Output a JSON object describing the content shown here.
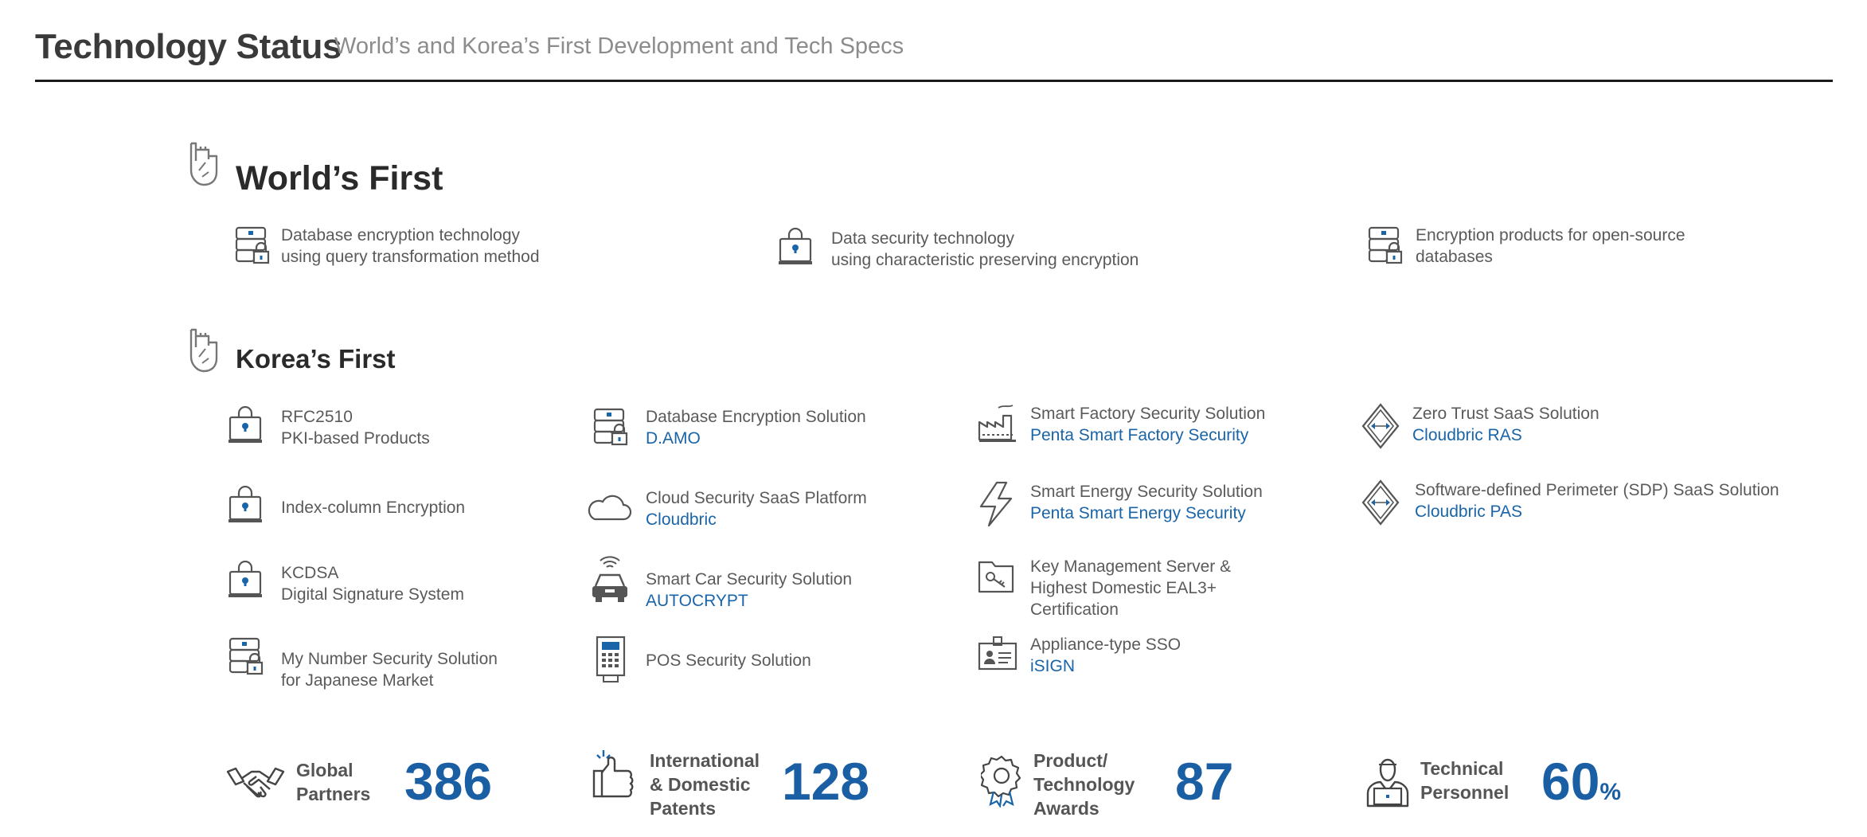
{
  "header": {
    "title": "Technology Status",
    "subtitle": "World’s and Korea’s First Development and Tech Specs"
  },
  "world_first": {
    "title": "World’s First",
    "items": [
      {
        "icon": "database-lock-icon",
        "lines": [
          "Database encryption technology",
          "using query transformation method"
        ]
      },
      {
        "icon": "laptop-lock-icon",
        "lines": [
          "Data security technology",
          "using characteristic preserving encryption"
        ]
      },
      {
        "icon": "database-lock-icon",
        "lines": [
          "Encryption products for open-source",
          "databases"
        ]
      }
    ]
  },
  "korea_first": {
    "title": "Korea’s First",
    "columns": [
      [
        {
          "icon": "laptop-lock-icon",
          "lines": [
            "RFC2510",
            "PKI-based Products"
          ],
          "link": ""
        },
        {
          "icon": "laptop-lock-icon",
          "lines": [
            "Index-column Encryption"
          ],
          "link": ""
        },
        {
          "icon": "laptop-lock-icon",
          "lines": [
            "KCDSA",
            "Digital Signature System"
          ],
          "link": ""
        },
        {
          "icon": "database-lock-icon",
          "lines": [
            "My Number Security Solution",
            "for Japanese Market"
          ],
          "link": ""
        }
      ],
      [
        {
          "icon": "database-lock-icon",
          "lines": [
            "Database Encryption Solution"
          ],
          "link": "D.AMO"
        },
        {
          "icon": "cloud-icon",
          "lines": [
            "Cloud Security SaaS Platform"
          ],
          "link": "Cloudbric"
        },
        {
          "icon": "car-icon",
          "lines": [
            "Smart Car Security Solution"
          ],
          "link": "AUTOCRYPT"
        },
        {
          "icon": "pos-terminal-icon",
          "lines": [
            "POS Security Solution"
          ],
          "link": ""
        }
      ],
      [
        {
          "icon": "factory-icon",
          "lines": [
            "Smart Factory Security Solution"
          ],
          "link": "Penta Smart Factory Security"
        },
        {
          "icon": "lightning-icon",
          "lines": [
            "Smart Energy Security Solution"
          ],
          "link": "Penta Smart Energy Security"
        },
        {
          "icon": "key-folder-icon",
          "lines": [
            "Key Management Server &",
            "Highest Domestic EAL3+",
            "Certification"
          ],
          "link": ""
        },
        {
          "icon": "id-badge-icon",
          "lines": [
            "Appliance-type SSO"
          ],
          "link": "iSIGN"
        }
      ],
      [
        {
          "icon": "diamond-arrows-icon",
          "lines": [
            "Zero Trust SaaS Solution"
          ],
          "link": "Cloudbric RAS"
        },
        {
          "icon": "diamond-arrows-icon",
          "lines": [
            "Software-defined Perimeter (SDP) SaaS Solution"
          ],
          "link": "Cloudbric PAS"
        }
      ]
    ]
  },
  "stats": [
    {
      "icon": "handshake-icon",
      "label_lines": [
        "Global",
        "Partners"
      ],
      "value": "386",
      "unit": ""
    },
    {
      "icon": "thumbs-up-icon",
      "label_lines": [
        "International",
        "& Domestic",
        "Patents"
      ],
      "value": "128",
      "unit": ""
    },
    {
      "icon": "award-medal-icon",
      "label_lines": [
        "Product/",
        "Technology",
        "Awards"
      ],
      "value": "87",
      "unit": ""
    },
    {
      "icon": "technician-icon",
      "label_lines": [
        "Technical",
        "Personnel"
      ],
      "value": "60",
      "unit": "%"
    }
  ],
  "colors": {
    "accent": "#1a64a8",
    "text": "#5a5a5a",
    "rule": "#1b1b1b"
  }
}
